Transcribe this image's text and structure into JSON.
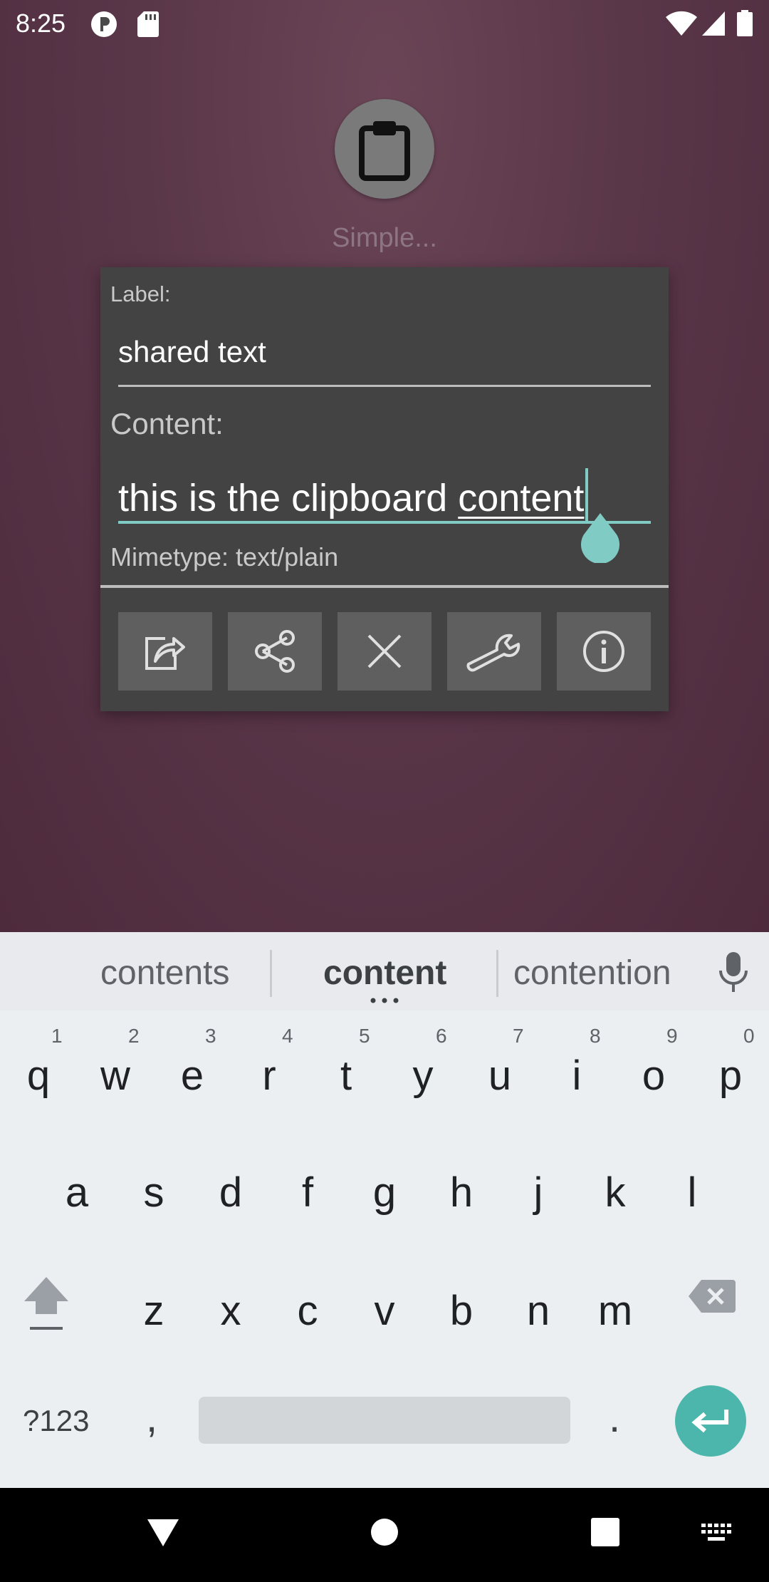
{
  "statusbar": {
    "time": "8:25"
  },
  "app": {
    "name": "Simple..."
  },
  "dialog": {
    "label_caption": "Label:",
    "label_value": "shared text",
    "content_caption": "Content:",
    "content_prefix": "this is the clipboard ",
    "content_word": "content",
    "mimetype": "Mimetype: text/plain",
    "actions": [
      "edit-icon",
      "share-icon",
      "close-icon",
      "wrench-icon",
      "info-icon"
    ]
  },
  "keyboard": {
    "suggestions": [
      "contents",
      "content",
      "contention"
    ],
    "row1": [
      {
        "ch": "q",
        "num": "1"
      },
      {
        "ch": "w",
        "num": "2"
      },
      {
        "ch": "e",
        "num": "3"
      },
      {
        "ch": "r",
        "num": "4"
      },
      {
        "ch": "t",
        "num": "5"
      },
      {
        "ch": "y",
        "num": "6"
      },
      {
        "ch": "u",
        "num": "7"
      },
      {
        "ch": "i",
        "num": "8"
      },
      {
        "ch": "o",
        "num": "9"
      },
      {
        "ch": "p",
        "num": "0"
      }
    ],
    "row2": [
      "a",
      "s",
      "d",
      "f",
      "g",
      "h",
      "j",
      "k",
      "l"
    ],
    "row3": [
      "z",
      "x",
      "c",
      "v",
      "b",
      "n",
      "m"
    ],
    "symbols_label": "?123",
    "comma": ",",
    "period": "."
  },
  "colors": {
    "accent": "#80cbc4",
    "enter": "#4db6ac",
    "dialog_bg": "#434343",
    "button_bg": "#5f5f5f"
  }
}
